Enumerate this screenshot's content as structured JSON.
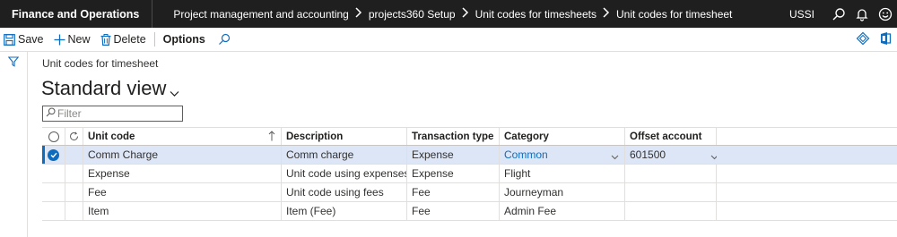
{
  "topbar": {
    "app_name": "Finance and Operations",
    "breadcrumbs": [
      "Project management and accounting",
      "projects360 Setup",
      "Unit codes for timesheets",
      "Unit codes for timesheet"
    ],
    "company": "USSI",
    "icons": [
      "search-icon",
      "bell-icon",
      "smiley-icon"
    ]
  },
  "actionbar": {
    "save": "Save",
    "new": "New",
    "delete": "Delete",
    "options": "Options",
    "right_icons": [
      "diamond-icon",
      "office-icon"
    ]
  },
  "page": {
    "caption": "Unit codes for timesheet",
    "view_title": "Standard view",
    "filter_placeholder": "Filter"
  },
  "grid": {
    "columns": {
      "unit_code": "Unit code",
      "description": "Description",
      "transaction_type": "Transaction type",
      "category": "Category",
      "offset_account": "Offset account"
    },
    "rows": [
      {
        "unit_code": "Comm Charge",
        "description": "Comm charge",
        "transaction_type": "Expense",
        "category": "Common",
        "offset_account": "601500",
        "selected": true
      },
      {
        "unit_code": "Expense",
        "description": "Unit code using expenses",
        "transaction_type": "Expense",
        "category": "Flight",
        "offset_account": "",
        "selected": false
      },
      {
        "unit_code": "Fee",
        "description": "Unit code using fees",
        "transaction_type": "Fee",
        "category": "Journeyman",
        "offset_account": "",
        "selected": false
      },
      {
        "unit_code": "Item",
        "description": "Item (Fee)",
        "transaction_type": "Fee",
        "category": "Admin Fee",
        "offset_account": "",
        "selected": false
      }
    ]
  },
  "colors": {
    "topbar_bg": "#1f1f1f",
    "accent": "#0f6cbd",
    "selected_row": "#dde6f7"
  }
}
